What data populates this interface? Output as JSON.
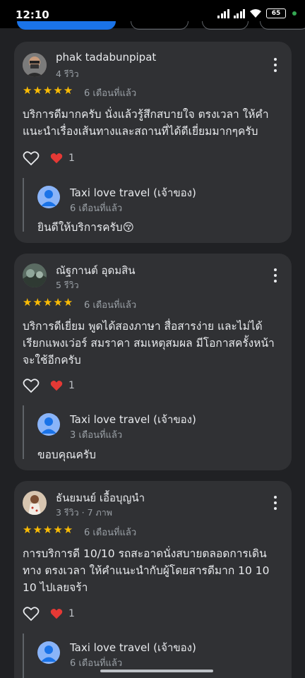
{
  "status": {
    "time": "12:10",
    "battery": "65"
  },
  "reviews": [
    {
      "name": "phak tadabunpipat",
      "meta": "4 รีวิว",
      "stars": "★★★★★",
      "time": "6 เดือนที่แล้ว",
      "text": "บริการดีมากครับ นั่งแล้วรู้สึกสบายใจ ตรงเวลา ให้คำแนะนำเรื่องเส้นทางและสถานที่ได้ดีเยี่ยมมากๆครับ",
      "likes": "1",
      "owner": {
        "name": "Taxi love travel (เจ้าของ)",
        "time": "6 เดือนที่แล้ว",
        "reply": "ยินดีให้บริการครับ😚"
      }
    },
    {
      "name": "ณัฐกานต์ อุดมสิน",
      "meta": "5 รีวิว",
      "stars": "★★★★★",
      "time": "6 เดือนที่แล้ว",
      "text": "บริการดีเยี่ยม พูดได้สองภาษา สื่อสารง่าย และไม่ได้เรียกแพงเว่อร์ สมราคา สมเหตุสมผล มีโอกาสครั้งหน้าจะใช้อีกครับ",
      "likes": "1",
      "owner": {
        "name": "Taxi love travel (เจ้าของ)",
        "time": "3 เดือนที่แล้ว",
        "reply": "ขอบคุณครับ"
      }
    },
    {
      "name": "ธันยมนย์ เอื้อบุญนำ",
      "meta": "3 รีวิว · 7 ภาพ",
      "stars": "★★★★★",
      "time": "6 เดือนที่แล้ว",
      "text": "การบริการดี 10/10 รถสะอาดนั่งสบายตลอดการเดินทาง ตรงเวลา ให้คำแนะนำกับผู้โดยสารดีมาก 10 10 10 ไปเลยจร้า",
      "likes": "1",
      "owner": {
        "name": "Taxi love travel (เจ้าของ)",
        "time": "6 เดือนที่แล้ว",
        "reply": ""
      }
    }
  ]
}
